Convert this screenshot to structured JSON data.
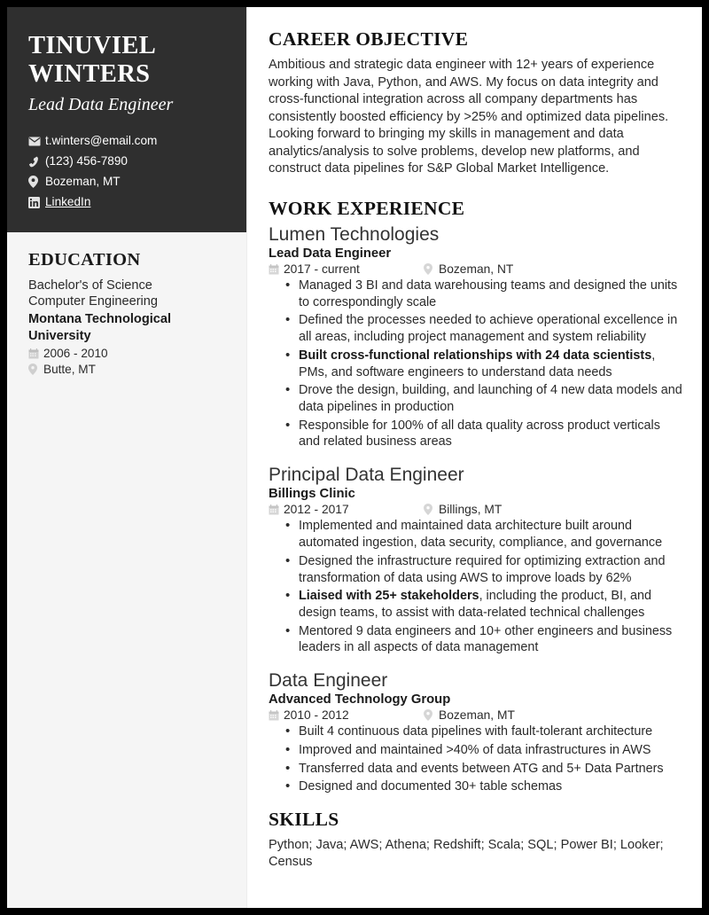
{
  "sidebar": {
    "name_line1": "TINUVIEL",
    "name_line2": "WINTERS",
    "headline": "Lead Data Engineer",
    "contacts": [
      {
        "icon": "envelope-icon",
        "text": "t.winters@email.com",
        "link": false
      },
      {
        "icon": "phone-icon",
        "text": "(123) 456-7890",
        "link": false
      },
      {
        "icon": "map-pin-icon",
        "text": "Bozeman, MT",
        "link": false
      },
      {
        "icon": "linkedin-icon",
        "text": "LinkedIn",
        "link": true
      }
    ],
    "education": {
      "title": "EDUCATION",
      "degree": "Bachelor's of Science",
      "field": "Computer Engineering",
      "school": "Montana Technological University",
      "dates": "2006 - 2010",
      "location": "Butte, MT"
    }
  },
  "main": {
    "objective": {
      "title": "CAREER OBJECTIVE",
      "text": "Ambitious and strategic data engineer with 12+ years of experience working with Java, Python, and AWS. My focus on data integrity and cross-functional integration across all company departments has consistently boosted efficiency by >25% and optimized data pipelines. Looking forward to bringing my skills in management and data analytics/analysis to solve problems, develop new platforms, and construct data pipelines for S&P Global Market Intelligence."
    },
    "work": {
      "title": "WORK EXPERIENCE",
      "jobs": [
        {
          "company": "Lumen Technologies",
          "role": "Lead Data Engineer",
          "dates": "2017 - current",
          "location": "Bozeman, NT",
          "bullets": [
            {
              "bold": "",
              "text": "Managed 3 BI and data warehousing teams and designed the units to correspondingly scale"
            },
            {
              "bold": "",
              "text": "Defined the processes needed to achieve operational excellence in all areas, including project management and system reliability"
            },
            {
              "bold": "Built cross-functional relationships with 24 data scientists",
              "text": ", PMs, and software engineers to understand data needs"
            },
            {
              "bold": "",
              "text": "Drove the design, building, and launching of 4 new data models and data pipelines in production"
            },
            {
              "bold": "",
              "text": "Responsible for 100% of all data quality across product verticals and related business areas"
            }
          ]
        },
        {
          "company": "Principal Data Engineer",
          "role": "Billings Clinic",
          "dates": "2012 - 2017",
          "location": "Billings, MT",
          "bullets": [
            {
              "bold": "",
              "text": "Implemented and maintained data architecture built around automated ingestion, data security, compliance, and governance"
            },
            {
              "bold": "",
              "text": "Designed the infrastructure required for optimizing extraction and transformation of data using AWS to improve loads by 62%"
            },
            {
              "bold": "Liaised with 25+ stakeholders",
              "text": ", including the product, BI, and design teams, to assist with data-related technical challenges"
            },
            {
              "bold": "",
              "text": "Mentored 9 data engineers and 10+ other engineers and business leaders in all aspects of data management"
            }
          ]
        },
        {
          "company": "Data Engineer",
          "role": "Advanced Technology Group",
          "dates": "2010 - 2012",
          "location": "Bozeman, MT",
          "bullets": [
            {
              "bold": "",
              "text": "Built 4 continuous data pipelines with fault-tolerant architecture"
            },
            {
              "bold": "",
              "text": "Improved and maintained >40% of data infrastructures in AWS"
            },
            {
              "bold": "",
              "text": "Transferred data and events between ATG and 5+ Data Partners"
            },
            {
              "bold": "",
              "text": "Designed and documented 30+ table schemas"
            }
          ]
        }
      ]
    },
    "skills": {
      "title": "SKILLS",
      "text": "Python; Java; AWS; Athena; Redshift; Scala; SQL; Power BI; Looker; Census"
    }
  },
  "colors": {
    "sidebar_dark": "#2f2f2f",
    "sidebar_light": "#f5f5f5",
    "page_border": "#000000",
    "text_dark": "#1a1a1a"
  }
}
